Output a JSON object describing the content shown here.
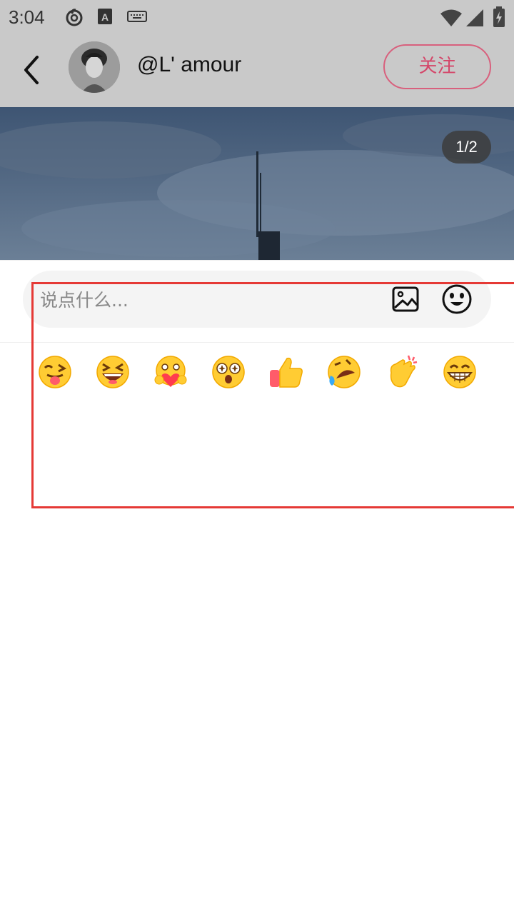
{
  "status_bar": {
    "time": "3:04",
    "icons": [
      "netease-music-icon",
      "font-icon",
      "keyboard-icon",
      "wifi-icon",
      "signal-icon",
      "battery-icon"
    ]
  },
  "header": {
    "back_icon": "back-arrow-icon",
    "username": "@L' amour",
    "follow_label": "关注",
    "follow_color": "#d4476a"
  },
  "photo": {
    "page_indicator": "1/2"
  },
  "comment": {
    "placeholder": "说点什么...",
    "image_icon": "image-icon",
    "emoji_icon": "emoji-icon"
  },
  "emojis": [
    "tongue-wink",
    "grinning-squint",
    "heart-hug",
    "star-struck",
    "thumbs-up",
    "rolling-laughing",
    "clapping-hands",
    "big-grin"
  ],
  "highlight_color": "#e53935"
}
